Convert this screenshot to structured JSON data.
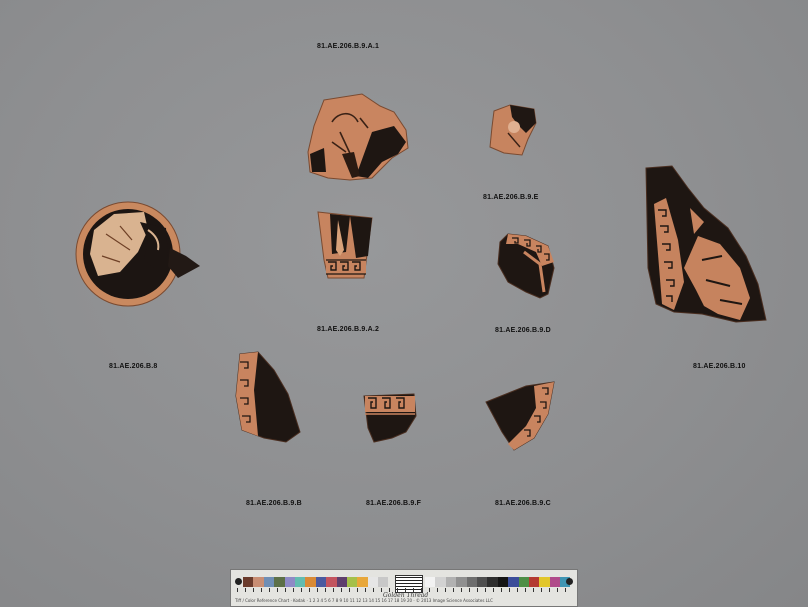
{
  "labels": {
    "a1": "81.AE.206.B.9.A.1",
    "a2": "81.AE.206.B.9.A.2",
    "e": "81.AE.206.B.9.E",
    "d": "81.AE.206.B.9.D",
    "b8": "81.AE.206.B.8",
    "b10": "81.AE.206.B.10",
    "b": "81.AE.206.B.9.B",
    "f": "81.AE.206.B.9.F",
    "c": "81.AE.206.B.9.C"
  },
  "colors": {
    "background": "#8e8f91",
    "terracotta": "#c8835e",
    "glaze": "#1d1613"
  },
  "ruler": {
    "brand": "Golden Thread",
    "fine_print": "Tiff / Color Reference Chart · Kodak · 1 2 3 4 5 6 7 8 9 10 11 12 13 14 15 16 17 18 19 20 · © 2013 Image Science Associates LLC",
    "patches": [
      "#6b3b2c",
      "#c98e74",
      "#6f8eb5",
      "#5d7048",
      "#8e8ac6",
      "#62bcb0",
      "#d98a36",
      "#4a5aa0",
      "#c3545f",
      "#5f3f6d",
      "#a5c04a",
      "#e8a73a",
      "#e6e6e6",
      "#c8c8c8",
      "#a3a3a3",
      "#7a7a7a",
      "#555555",
      "#343434"
    ],
    "patches_right": [
      "#f2f2f2",
      "#d2d2d2",
      "#b1b1b1",
      "#909090",
      "#6e6e6e",
      "#4f4f4f",
      "#2e2e2e",
      "#151515",
      "#3b4d9a",
      "#4e8f46",
      "#b43a32",
      "#e2c62a",
      "#b04a8a",
      "#3f95b3",
      "#e2e2e2",
      "#242424"
    ]
  }
}
